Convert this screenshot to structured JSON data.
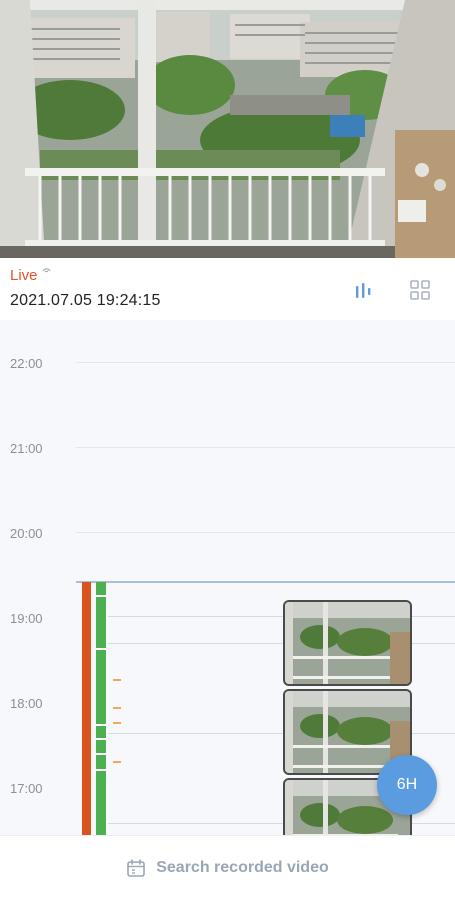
{
  "live": {
    "label": "Live",
    "timestamp": "2021.07.05 19:24:15"
  },
  "view_buttons": [
    {
      "name": "timeline-view",
      "icon": "timeline-bars-icon",
      "active": true
    },
    {
      "name": "grid-view",
      "icon": "grid-icon",
      "active": false
    }
  ],
  "timeline": {
    "hours": [
      {
        "label": "22:00"
      },
      {
        "label": "21:00"
      },
      {
        "label": "20:00"
      },
      {
        "label": "19:00"
      },
      {
        "label": "18:00"
      },
      {
        "label": "17:00"
      }
    ],
    "thumbnails": 3
  },
  "range_button": {
    "label": "6H"
  },
  "search": {
    "icon": "calendar-icon",
    "label": "Search recorded video"
  },
  "colors": {
    "live": "#e8542a",
    "accent": "#5b9be0",
    "event_motion": "#d9531e",
    "recording": "#4caf50",
    "event_tick": "#f0a85a"
  }
}
